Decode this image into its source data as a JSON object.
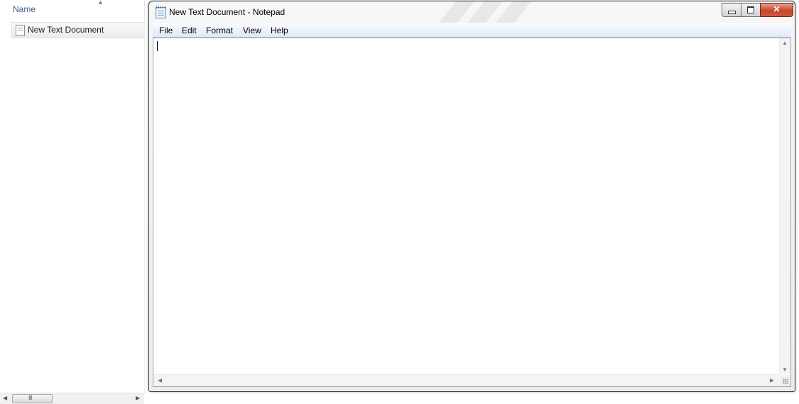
{
  "explorer": {
    "column_header": "Name",
    "sort_icon": "sort-ascending-icon",
    "files": [
      {
        "label": "New Text Document",
        "icon": "text-document-icon"
      }
    ],
    "scrollbar": {
      "left_icon": "scroll-left-arrow-icon",
      "right_icon": "scroll-right-arrow-icon",
      "grip": "III"
    }
  },
  "notepad": {
    "title": "New Text Document - Notepad",
    "icon": "notepad-icon",
    "caption": {
      "minimize_icon": "minimize-icon",
      "maximize_icon": "maximize-icon",
      "close_icon": "close-icon",
      "close_glyph": "✕"
    },
    "menu": [
      "File",
      "Edit",
      "Format",
      "View",
      "Help"
    ],
    "editor": {
      "content": ""
    },
    "colors": {
      "close_button": "#c7472b",
      "menubar": "#dfe9f5",
      "frame": "#ececec"
    }
  }
}
